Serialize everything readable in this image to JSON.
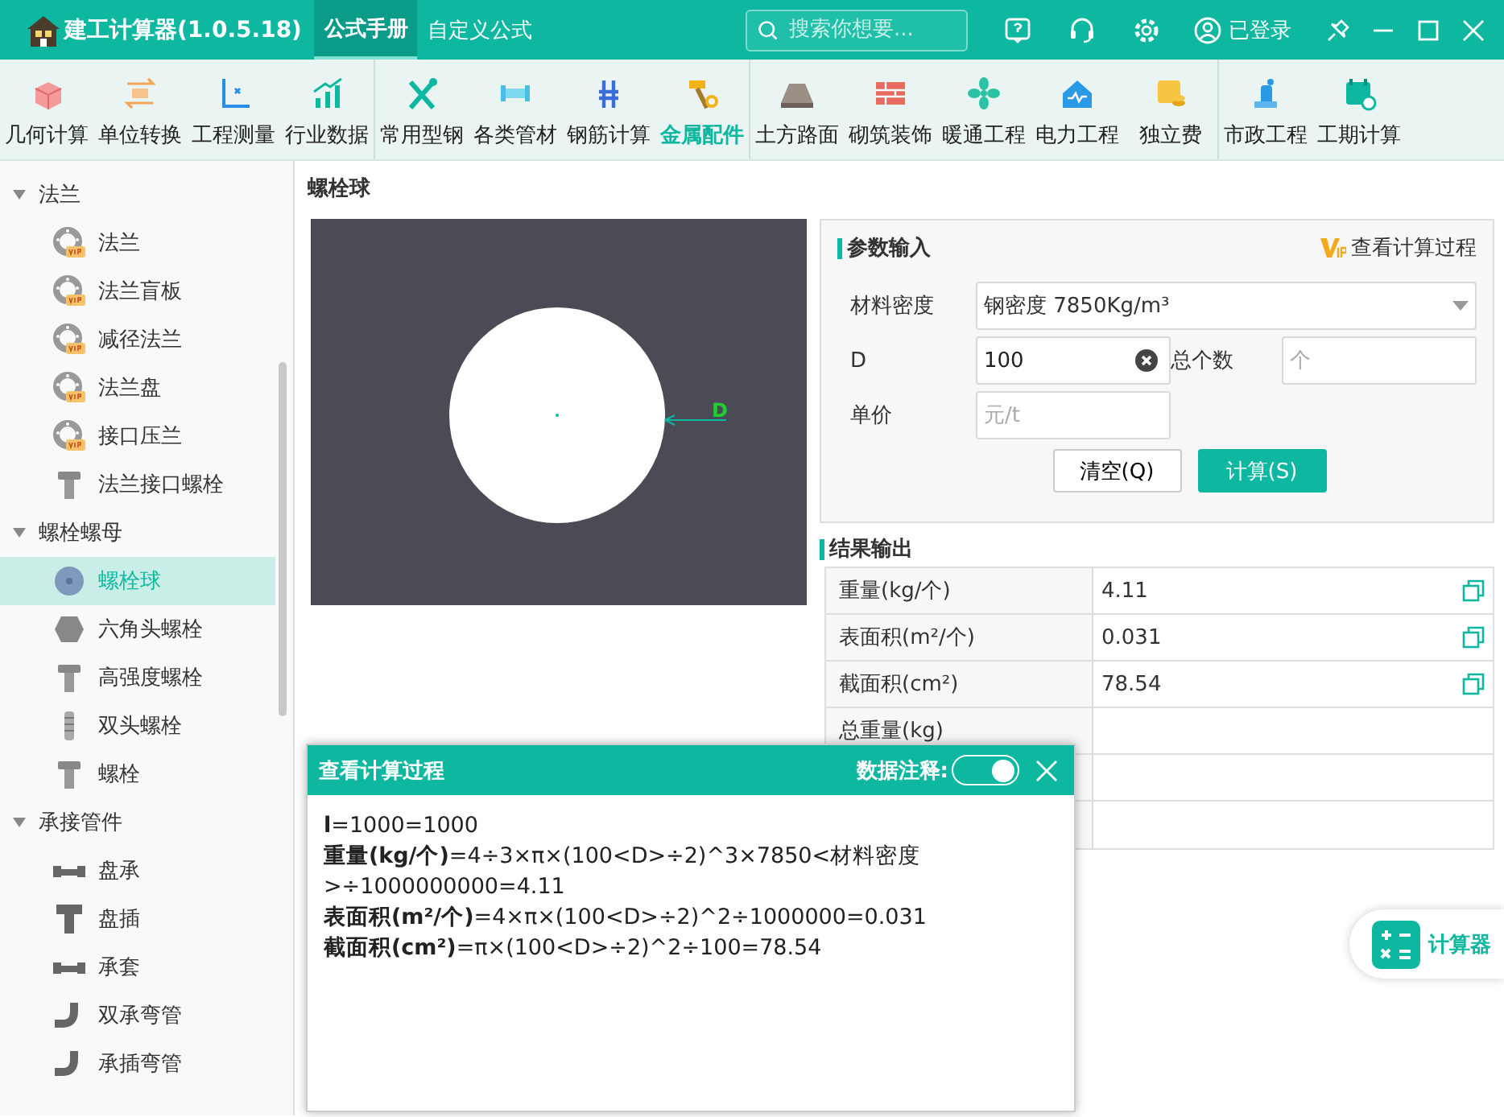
{
  "app": {
    "title": "建工计算器(1.0.5.18)",
    "tabs": [
      {
        "label": "公式手册",
        "selected": true
      },
      {
        "label": "自定义公式",
        "selected": false
      }
    ],
    "search": {
      "placeholder": "搜索你想要..."
    },
    "user": "已登录"
  },
  "toolbar": [
    [
      {
        "label": "几何计算",
        "kind": "cube",
        "selected": false
      },
      {
        "label": "单位转换",
        "kind": "unit",
        "selected": false
      },
      {
        "label": "工程测量",
        "kind": "axis",
        "selected": false
      },
      {
        "label": "行业数据",
        "kind": "chart",
        "selected": false
      }
    ],
    [
      {
        "label": "常用型钢",
        "kind": "tools",
        "selected": false
      },
      {
        "label": "各类管材",
        "kind": "pipe",
        "selected": false
      },
      {
        "label": "钢筋计算",
        "kind": "rebar",
        "selected": false
      },
      {
        "label": "金属配件",
        "kind": "hammer",
        "selected": true
      }
    ],
    [
      {
        "label": "土方路面",
        "kind": "road",
        "selected": false
      },
      {
        "label": "砌筑装饰",
        "kind": "brick",
        "selected": false
      },
      {
        "label": "暖通工程",
        "kind": "fan",
        "selected": false
      },
      {
        "label": "电力工程",
        "kind": "house",
        "selected": false
      },
      {
        "label": "独立费",
        "kind": "coin",
        "selected": false
      }
    ],
    [
      {
        "label": "市政工程",
        "kind": "hydrant",
        "selected": false
      },
      {
        "label": "工期计算",
        "kind": "calendar",
        "selected": false
      }
    ]
  ],
  "sidebar": [
    {
      "label": "法兰",
      "expanded": true,
      "children": [
        {
          "label": "法兰",
          "kind": "vip",
          "selected": false
        },
        {
          "label": "法兰盲板",
          "kind": "vip",
          "selected": false
        },
        {
          "label": "减径法兰",
          "kind": "vip",
          "selected": false
        },
        {
          "label": "法兰盘",
          "kind": "vip",
          "selected": false
        },
        {
          "label": "接口压兰",
          "kind": "vip",
          "selected": false
        },
        {
          "label": "法兰接口螺栓",
          "kind": "bolt",
          "selected": false
        }
      ]
    },
    {
      "label": "螺栓螺母",
      "expanded": true,
      "children": [
        {
          "label": "螺栓球",
          "kind": "ball",
          "selected": true
        },
        {
          "label": "六角头螺栓",
          "kind": "hex",
          "selected": false
        },
        {
          "label": "高强度螺栓",
          "kind": "bolt",
          "selected": false
        },
        {
          "label": "双头螺栓",
          "kind": "stud",
          "selected": false
        },
        {
          "label": "螺栓",
          "kind": "bolt",
          "selected": false
        }
      ]
    },
    {
      "label": "承接管件",
      "expanded": true,
      "children": [
        {
          "label": "盘承",
          "kind": "fitting",
          "selected": false
        },
        {
          "label": "盘插",
          "kind": "tee",
          "selected": false
        },
        {
          "label": "承套",
          "kind": "fitting",
          "selected": false
        },
        {
          "label": "双承弯管",
          "kind": "elbow",
          "selected": false
        },
        {
          "label": "承插弯管",
          "kind": "elbow",
          "selected": false
        }
      ]
    }
  ],
  "page_title": "螺栓球",
  "diagram": {
    "dimension": "D"
  },
  "params": {
    "title": "参数输入",
    "process_link": "查看计算过程",
    "fields": [
      {
        "label": "材料密度",
        "kind": "select",
        "value": "钢密度 7850Kg/m³"
      },
      {
        "label": "D",
        "kind": "input",
        "value": "100"
      },
      {
        "label": "总个数",
        "kind": "input",
        "placeholder": "个"
      },
      {
        "label": "单价",
        "kind": "input",
        "placeholder": "元/t"
      }
    ],
    "buttons": [
      {
        "label": "清空(Q)",
        "kind": "secondary"
      },
      {
        "label": "计算(S)",
        "kind": "primary"
      }
    ]
  },
  "results": {
    "title": "结果输出",
    "rows": [
      {
        "label": "重量(kg/个)",
        "value": "4.11"
      },
      {
        "label": "表面积(m²/个)",
        "value": "0.031"
      },
      {
        "label": "截面积(cm²)",
        "value": "78.54"
      },
      {
        "label": "总重量(kg)"
      }
    ]
  },
  "process_popup": {
    "title": "查看计算过程",
    "toggle_label": "数据注释:",
    "annotations_on": true,
    "lines": [
      "**l**=1000=1000",
      "**重量(kg/个)**=4÷3×π×(100<D>÷2)^3×7850<材料密度>÷1000000000=4.11",
      "**表面积(m²/个)**=4×π×(100<D>÷2)^2÷1000000=0.031",
      "**截面积(cm²)**=π×(100<D>÷2)^2÷100=78.54"
    ]
  },
  "float_button": "计算器"
}
